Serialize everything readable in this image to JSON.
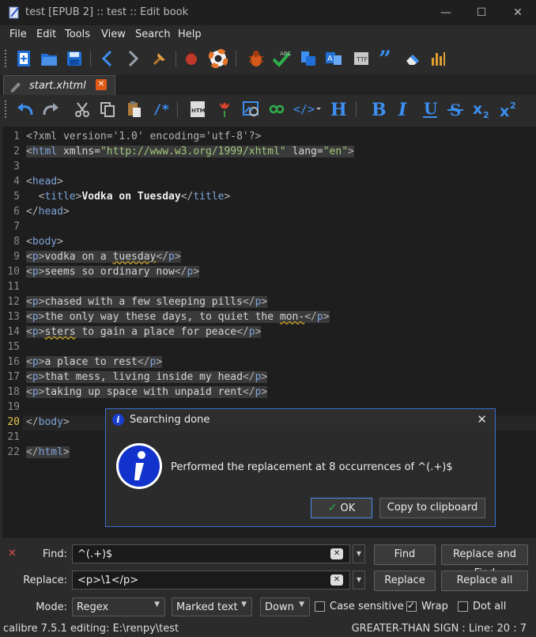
{
  "window": {
    "title": "test [EPUB 2] :: test :: Edit book",
    "minimize": "—",
    "maximize": "☐",
    "close": "✕"
  },
  "menu": [
    "File",
    "Edit",
    "Tools",
    "View",
    "Search",
    "Help"
  ],
  "tab": {
    "label": "start.xhtml",
    "close": "✕"
  },
  "editor": {
    "line_numbers": [
      "1",
      "2",
      "3",
      "4",
      "5",
      "6",
      "7",
      "8",
      "9",
      "10",
      "11",
      "12",
      "13",
      "14",
      "15",
      "16",
      "17",
      "18",
      "19",
      "20",
      "21",
      "22"
    ],
    "current_line": "20"
  },
  "find_panel": {
    "close": "✕",
    "find_label": "Find:",
    "find_value": "^(.+)$",
    "replace_label": "Replace:",
    "replace_value": "<p>\\1</p>",
    "mode_label": "Mode:",
    "mode_value": "Regex",
    "marked_value": "Marked text",
    "direction_value": "Down",
    "buttons": {
      "find": "Find",
      "replace_and_find": "Replace and Find",
      "replace": "Replace",
      "replace_all": "Replace all"
    },
    "options": {
      "case_sensitive": {
        "label": "Case sensitive",
        "checked": false
      },
      "wrap": {
        "label": "Wrap",
        "checked": true
      },
      "dot_all": {
        "label": "Dot all",
        "checked": false
      }
    }
  },
  "dialog": {
    "title": "Searching done",
    "message": "Performed the replacement at 8 occurrences of ^(.+)$",
    "ok": "OK",
    "copy": "Copy to clipboard",
    "close": "✕"
  },
  "status": {
    "left": "calibre 7.5.1 editing: E:\\renpy\\test",
    "right": "GREATER-THAN SIGN : Line: 20 : 7"
  },
  "colors": {
    "background": "#2b2b2b",
    "editor_bg": "#1e1e1e",
    "accent": "#3a6fd0",
    "tag_name": "#7ea4d8",
    "string": "#9fc97a",
    "current_line_number": "#e8c64a"
  }
}
